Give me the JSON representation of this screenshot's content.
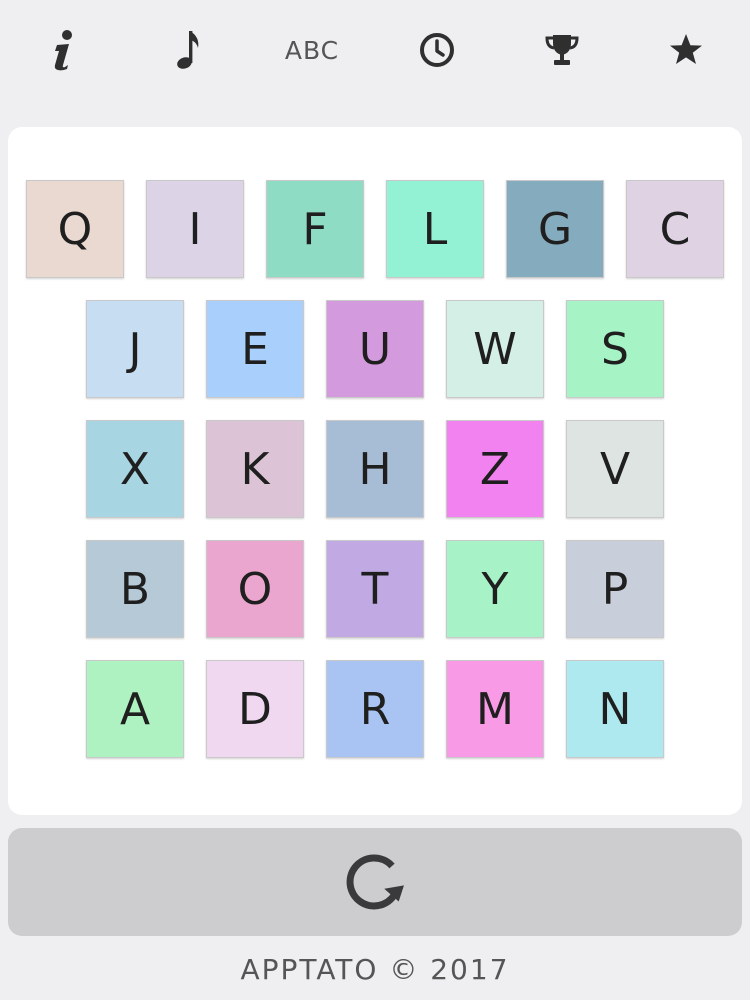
{
  "toolbar": {
    "items": [
      {
        "name": "info-icon",
        "kind": "icon"
      },
      {
        "name": "music-note-icon",
        "kind": "icon"
      },
      {
        "name": "abc-mode-button",
        "kind": "text",
        "label": "ABC"
      },
      {
        "name": "clock-icon",
        "kind": "icon"
      },
      {
        "name": "trophy-icon",
        "kind": "icon"
      },
      {
        "name": "star-icon",
        "kind": "icon"
      }
    ]
  },
  "board": {
    "rows": [
      [
        {
          "letter": "Q",
          "color": "#ead9d1"
        },
        {
          "letter": "I",
          "color": "#dcd4e6"
        },
        {
          "letter": "F",
          "color": "#8fdcc5"
        },
        {
          "letter": "L",
          "color": "#94f2d4"
        },
        {
          "letter": "G",
          "color": "#85abbf"
        },
        {
          "letter": "C",
          "color": "#dfd3e3"
        }
      ],
      [
        {
          "letter": "J",
          "color": "#c7def2"
        },
        {
          "letter": "E",
          "color": "#a9d0fc"
        },
        {
          "letter": "U",
          "color": "#d49ade"
        },
        {
          "letter": "W",
          "color": "#d3efe6"
        },
        {
          "letter": "S",
          "color": "#a6f4c5"
        }
      ],
      [
        {
          "letter": "X",
          "color": "#a7d5e2"
        },
        {
          "letter": "K",
          "color": "#dcc4d6"
        },
        {
          "letter": "H",
          "color": "#a7bdd6"
        },
        {
          "letter": "Z",
          "color": "#f282f0"
        },
        {
          "letter": "V",
          "color": "#dee4e2"
        }
      ],
      [
        {
          "letter": "B",
          "color": "#b5cad6"
        },
        {
          "letter": "O",
          "color": "#eba6cf"
        },
        {
          "letter": "T",
          "color": "#c1a9e3"
        },
        {
          "letter": "Y",
          "color": "#a8f2c7"
        },
        {
          "letter": "P",
          "color": "#c9cedb"
        }
      ],
      [
        {
          "letter": "A",
          "color": "#adf2c0"
        },
        {
          "letter": "D",
          "color": "#efd8f0"
        },
        {
          "letter": "R",
          "color": "#a9c3f2"
        },
        {
          "letter": "M",
          "color": "#f99ae6"
        },
        {
          "letter": "N",
          "color": "#aee9ef"
        }
      ]
    ]
  },
  "reset": {
    "icon": "refresh-icon"
  },
  "footer": {
    "text": "APPTATO © 2017"
  }
}
